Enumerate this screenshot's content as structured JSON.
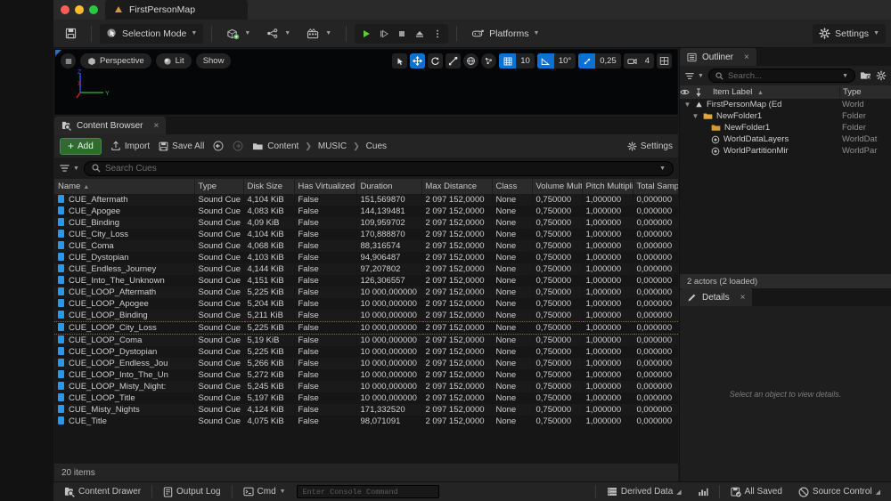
{
  "window": {
    "document_tab": "FirstPersonMap"
  },
  "toolbar": {
    "save_icon": "save-icon",
    "selection_mode": "Selection Mode",
    "add_actor_icon": "add-actor-icon",
    "blueprints_icon": "blueprints-icon",
    "cinematics_icon": "cinematics-icon",
    "play": "play-icon",
    "skip": "skip-icon",
    "stop": "stop-icon",
    "eject": "eject-icon",
    "more": "more-options-icon",
    "platforms": "Platforms",
    "settings": "Settings"
  },
  "viewport": {
    "menu_icon": "viewport-menu-icon",
    "perspective": "Perspective",
    "lit": "Lit",
    "show": "Show",
    "grid_snap_value": "10",
    "angle_snap_value": "10°",
    "scale_snap_value": "0,25",
    "camera_speed_value": "4",
    "gizmo_axes": {
      "x": "X",
      "y": "Y",
      "z": "Z"
    },
    "accent_blue": "#0c71d1"
  },
  "content_browser": {
    "tab_label": "Content Browser",
    "close_label": "×",
    "add_label": "Add",
    "import_label": "Import",
    "save_all_label": "Save All",
    "settings_label": "Settings",
    "breadcrumb": [
      "Content",
      "MUSIC",
      "Cues"
    ],
    "search_placeholder": "Search Cues",
    "footer_count": "20 items",
    "columns": [
      "Name",
      "Type",
      "Disk Size",
      "Has Virtualized Data",
      "Duration",
      "Max Distance",
      "Class",
      "Volume Multiplier",
      "Pitch Multiplier",
      "Total Samples"
    ],
    "sort_column": "Name",
    "sort_dir": "asc",
    "rows": [
      {
        "name": "CUE_Aftermath",
        "type": "Sound Cue",
        "disk": "4,104 KiB",
        "virt": "False",
        "dur": "151,569870",
        "maxd": "2 097 152,0000",
        "class": "None",
        "vol": "0,750000",
        "pitch": "1,000000",
        "samples": "0,000000"
      },
      {
        "name": "CUE_Apogee",
        "type": "Sound Cue",
        "disk": "4,083 KiB",
        "virt": "False",
        "dur": "144,139481",
        "maxd": "2 097 152,0000",
        "class": "None",
        "vol": "0,750000",
        "pitch": "1,000000",
        "samples": "0,000000"
      },
      {
        "name": "CUE_Binding",
        "type": "Sound Cue",
        "disk": "4,09 KiB",
        "virt": "False",
        "dur": "109,959702",
        "maxd": "2 097 152,0000",
        "class": "None",
        "vol": "0,750000",
        "pitch": "1,000000",
        "samples": "0,000000"
      },
      {
        "name": "CUE_City_Loss",
        "type": "Sound Cue",
        "disk": "4,104 KiB",
        "virt": "False",
        "dur": "170,888870",
        "maxd": "2 097 152,0000",
        "class": "None",
        "vol": "0,750000",
        "pitch": "1,000000",
        "samples": "0,000000"
      },
      {
        "name": "CUE_Coma",
        "type": "Sound Cue",
        "disk": "4,068 KiB",
        "virt": "False",
        "dur": "88,316574",
        "maxd": "2 097 152,0000",
        "class": "None",
        "vol": "0,750000",
        "pitch": "1,000000",
        "samples": "0,000000"
      },
      {
        "name": "CUE_Dystopian",
        "type": "Sound Cue",
        "disk": "4,103 KiB",
        "virt": "False",
        "dur": "94,906487",
        "maxd": "2 097 152,0000",
        "class": "None",
        "vol": "0,750000",
        "pitch": "1,000000",
        "samples": "0,000000"
      },
      {
        "name": "CUE_Endless_Journey",
        "type": "Sound Cue",
        "disk": "4,144 KiB",
        "virt": "False",
        "dur": "97,207802",
        "maxd": "2 097 152,0000",
        "class": "None",
        "vol": "0,750000",
        "pitch": "1,000000",
        "samples": "0,000000"
      },
      {
        "name": "CUE_Into_The_Unknown",
        "type": "Sound Cue",
        "disk": "4,151 KiB",
        "virt": "False",
        "dur": "126,306557",
        "maxd": "2 097 152,0000",
        "class": "None",
        "vol": "0,750000",
        "pitch": "1,000000",
        "samples": "0,000000"
      },
      {
        "name": "CUE_LOOP_Aftermath",
        "type": "Sound Cue",
        "disk": "5,225 KiB",
        "virt": "False",
        "dur": "10 000,000000",
        "maxd": "2 097 152,0000",
        "class": "None",
        "vol": "0,750000",
        "pitch": "1,000000",
        "samples": "0,000000"
      },
      {
        "name": "CUE_LOOP_Apogee",
        "type": "Sound Cue",
        "disk": "5,204 KiB",
        "virt": "False",
        "dur": "10 000,000000",
        "maxd": "2 097 152,0000",
        "class": "None",
        "vol": "0,750000",
        "pitch": "1,000000",
        "samples": "0,000000"
      },
      {
        "name": "CUE_LOOP_Binding",
        "type": "Sound Cue",
        "disk": "5,211 KiB",
        "virt": "False",
        "dur": "10 000,000000",
        "maxd": "2 097 152,0000",
        "class": "None",
        "vol": "0,750000",
        "pitch": "1,000000",
        "samples": "0,000000"
      },
      {
        "name": "CUE_LOOP_City_Loss",
        "type": "Sound Cue",
        "disk": "5,225 KiB",
        "virt": "False",
        "dur": "10 000,000000",
        "maxd": "2 097 152,0000",
        "class": "None",
        "vol": "0,750000",
        "pitch": "1,000000",
        "samples": "0,000000",
        "hover": true
      },
      {
        "name": "CUE_LOOP_Coma",
        "type": "Sound Cue",
        "disk": "5,19 KiB",
        "virt": "False",
        "dur": "10 000,000000",
        "maxd": "2 097 152,0000",
        "class": "None",
        "vol": "0,750000",
        "pitch": "1,000000",
        "samples": "0,000000"
      },
      {
        "name": "CUE_LOOP_Dystopian",
        "type": "Sound Cue",
        "disk": "5,225 KiB",
        "virt": "False",
        "dur": "10 000,000000",
        "maxd": "2 097 152,0000",
        "class": "None",
        "vol": "0,750000",
        "pitch": "1,000000",
        "samples": "0,000000"
      },
      {
        "name": "CUE_LOOP_Endless_Jou",
        "type": "Sound Cue",
        "disk": "5,266 KiB",
        "virt": "False",
        "dur": "10 000,000000",
        "maxd": "2 097 152,0000",
        "class": "None",
        "vol": "0,750000",
        "pitch": "1,000000",
        "samples": "0,000000"
      },
      {
        "name": "CUE_LOOP_Into_The_Un",
        "type": "Sound Cue",
        "disk": "5,272 KiB",
        "virt": "False",
        "dur": "10 000,000000",
        "maxd": "2 097 152,0000",
        "class": "None",
        "vol": "0,750000",
        "pitch": "1,000000",
        "samples": "0,000000"
      },
      {
        "name": "CUE_LOOP_Misty_Night:",
        "type": "Sound Cue",
        "disk": "5,245 KiB",
        "virt": "False",
        "dur": "10 000,000000",
        "maxd": "2 097 152,0000",
        "class": "None",
        "vol": "0,750000",
        "pitch": "1,000000",
        "samples": "0,000000"
      },
      {
        "name": "CUE_LOOP_Title",
        "type": "Sound Cue",
        "disk": "5,197 KiB",
        "virt": "False",
        "dur": "10 000,000000",
        "maxd": "2 097 152,0000",
        "class": "None",
        "vol": "0,750000",
        "pitch": "1,000000",
        "samples": "0,000000"
      },
      {
        "name": "CUE_Misty_Nights",
        "type": "Sound Cue",
        "disk": "4,124 KiB",
        "virt": "False",
        "dur": "171,332520",
        "maxd": "2 097 152,0000",
        "class": "None",
        "vol": "0,750000",
        "pitch": "1,000000",
        "samples": "0,000000"
      },
      {
        "name": "CUE_Title",
        "type": "Sound Cue",
        "disk": "4,075 KiB",
        "virt": "False",
        "dur": "98,071091",
        "maxd": "2 097 152,0000",
        "class": "None",
        "vol": "0,750000",
        "pitch": "1,000000",
        "samples": "0,000000"
      }
    ]
  },
  "outliner": {
    "tab_label": "Outliner",
    "close_label": "×",
    "search_placeholder": "Search...",
    "col_item_label": "Item Label",
    "col_type": "Type",
    "sort_dir": "asc",
    "items": [
      {
        "label": "FirstPersonMap (Ed",
        "type": "World",
        "depth": 0,
        "icon": "world-icon",
        "expanded": true,
        "has_chev": true
      },
      {
        "label": "NewFolder1",
        "type": "Folder",
        "depth": 1,
        "icon": "folder-open-icon",
        "expanded": true,
        "has_chev": true
      },
      {
        "label": "NewFolder1",
        "type": "Folder",
        "depth": 2,
        "icon": "folder-icon",
        "expanded": false,
        "has_chev": false
      },
      {
        "label": "WorldDataLayers",
        "type": "WorldDat",
        "depth": 2,
        "icon": "actor-icon",
        "expanded": false,
        "has_chev": false
      },
      {
        "label": "WorldPartitionMir",
        "type": "WorldPar",
        "depth": 2,
        "icon": "actor-icon",
        "expanded": false,
        "has_chev": false
      }
    ],
    "actor_count": "2 actors (2 loaded)"
  },
  "details": {
    "tab_label": "Details",
    "close_label": "×",
    "empty_hint": "Select an object to view details."
  },
  "status_bar": {
    "content_drawer": "Content Drawer",
    "output_log": "Output Log",
    "cmd": "Cmd",
    "console_placeholder": "Enter Console Command",
    "derived_data": "Derived Data",
    "all_saved": "All Saved",
    "source_control": "Source Control"
  }
}
